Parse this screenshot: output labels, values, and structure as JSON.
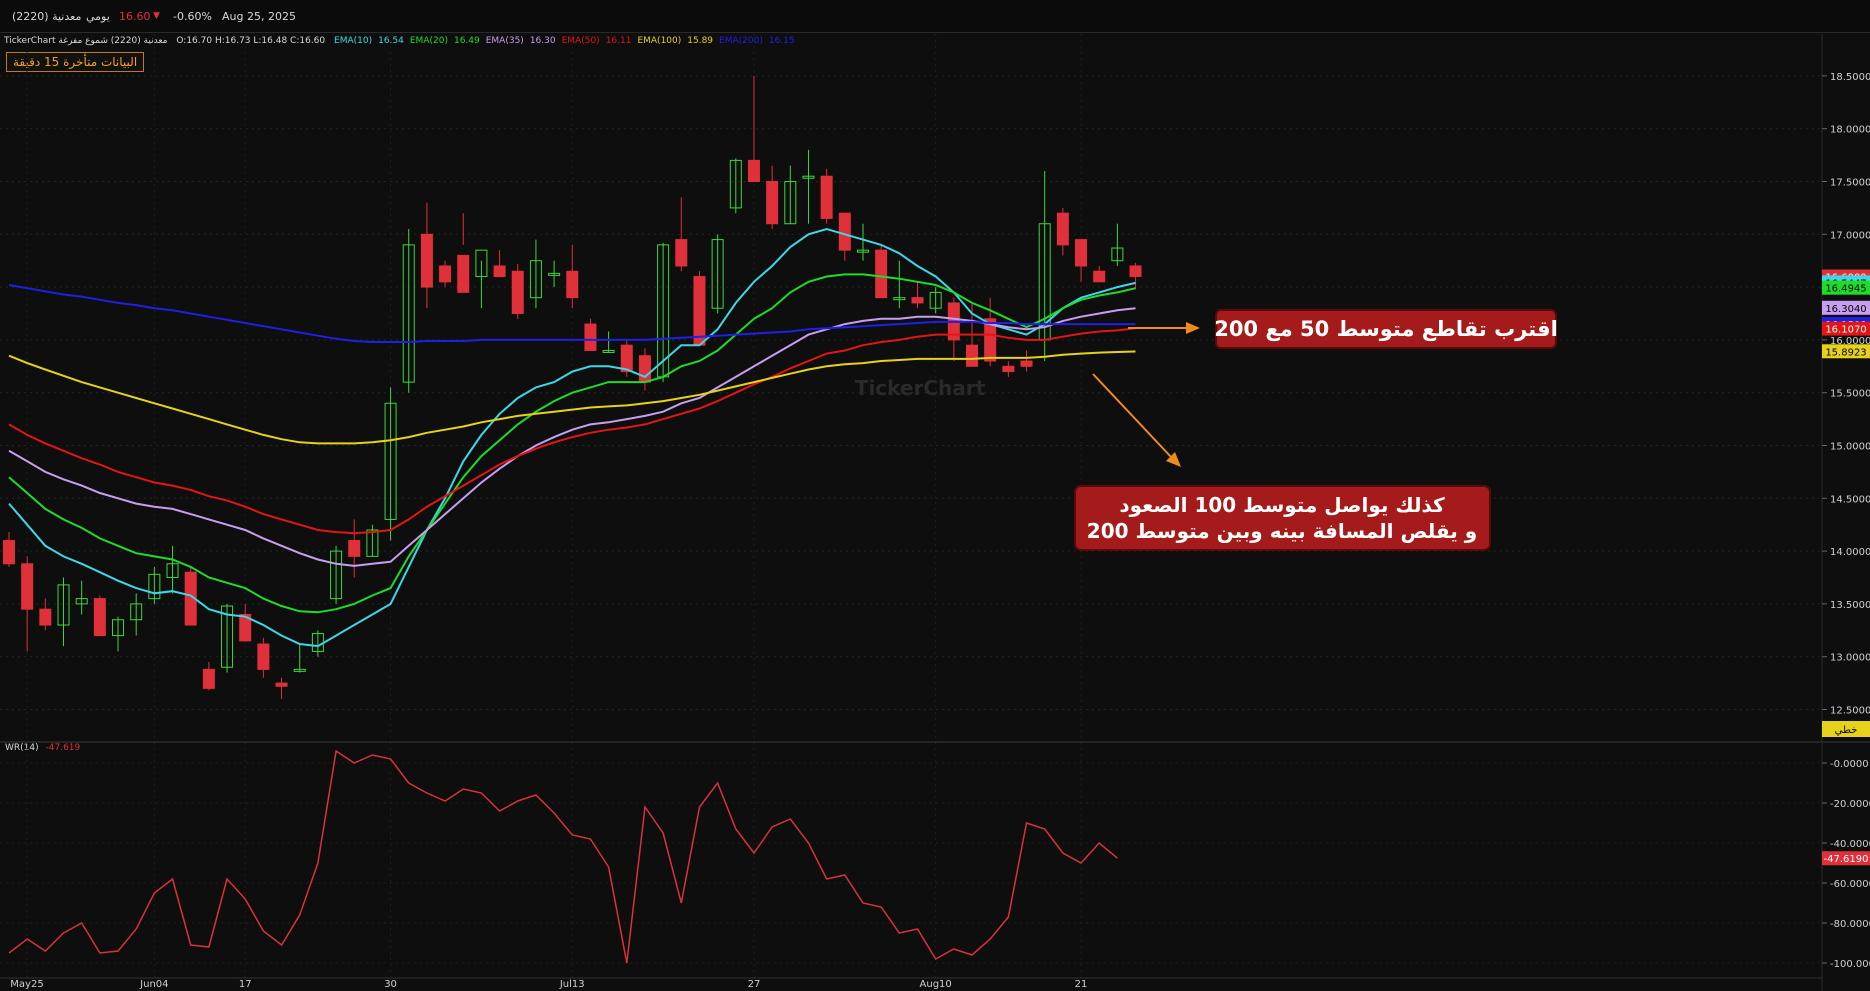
{
  "header": {
    "symbol": "معدنية (2220)",
    "period": "يومي",
    "price": "16.60",
    "change_pct": "-0.60%",
    "date": "Aug 25, 2025"
  },
  "legend": {
    "source": "TickerChart معدنية (2220) شموع مفرغة",
    "ohlc": "O:16.70  H:16.73  L:16.48  C:16.60",
    "items": [
      {
        "label": "EMA(10)",
        "value": "16.54",
        "color": "#3fd6e6"
      },
      {
        "label": "EMA(20)",
        "value": "16.49",
        "color": "#1fdc2a"
      },
      {
        "label": "EMA(35)",
        "value": "16.30",
        "color": "#c79ff0"
      },
      {
        "label": "EMA(50)",
        "value": "16.11",
        "color": "#e21616"
      },
      {
        "label": "EMA(100)",
        "value": "15.89",
        "color": "#e6d21a"
      },
      {
        "label": "EMA(200)",
        "value": "16.15",
        "color": "#1f1fe6"
      }
    ]
  },
  "delay_note": "البيانات متأخرة 15 دقيقة",
  "watermark": "TickerChart",
  "annotations": {
    "callout1": "اقترب  تقاطع  متوسط 50  مع  200",
    "callout2_line1": "كذلك  يواصل  متوسط 100  الصعود",
    "callout2_line2": "و  يقلص  المسافة  بينه  وبين  متوسط 200"
  },
  "price_tags": [
    {
      "text": "16.6000",
      "value": 16.6,
      "color": "#e0303a"
    },
    {
      "text": "16.5447",
      "value": 16.5447,
      "color": "#3fd6e6"
    },
    {
      "text": "16.4945",
      "value": 16.4945,
      "color": "#1fdc2a"
    },
    {
      "text": "16.3040",
      "value": 16.304,
      "color": "#c79ff0"
    },
    {
      "text": "16.1508",
      "value": 16.1508,
      "color": "#1f1fe6"
    },
    {
      "text": "16.1070",
      "value": 16.107,
      "color": "#e21616"
    },
    {
      "text": "15.8923",
      "value": 15.8923,
      "color": "#e6d21a"
    }
  ],
  "linear_label": "خطي",
  "wr": {
    "label": "WR(14)",
    "value": "-47.619",
    "tag": "-47.6190"
  },
  "chart_data": [
    {
      "type": "candlestick",
      "title": "معدنية (2220)",
      "x": [
        "May25",
        "",
        "",
        "",
        "",
        "",
        "",
        "",
        "Jun04",
        "",
        "",
        "",
        "",
        "17",
        "",
        "",
        "",
        "",
        "",
        "",
        "",
        "30",
        "",
        "",
        "",
        "",
        "",
        "",
        "",
        "",
        "",
        "Jul13",
        "",
        "",
        "",
        "",
        "",
        "",
        "",
        "",
        "",
        "27",
        "",
        "",
        "",
        "",
        "",
        "",
        "",
        "",
        "",
        "Aug10",
        "",
        "",
        "",
        "",
        "",
        "",
        "",
        "21",
        ""
      ],
      "x_tick_labels": [
        "May25",
        "Jun04",
        "17",
        "30",
        "Jul13",
        "27",
        "Aug10",
        "21"
      ],
      "y_ticks": [
        "12.5000",
        "13.0000",
        "13.5000",
        "14.0000",
        "14.5000",
        "15.0000",
        "15.5000",
        "16.0000",
        "16.5000",
        "17.0000",
        "17.5000",
        "18.0000",
        "18.5000"
      ],
      "ylim": [
        12.3,
        18.75
      ],
      "ohlc": [
        [
          14.1,
          14.18,
          13.85,
          13.88
        ],
        [
          13.88,
          13.95,
          13.05,
          13.45
        ],
        [
          13.45,
          13.55,
          13.25,
          13.3
        ],
        [
          13.3,
          13.75,
          13.1,
          13.68
        ],
        [
          13.5,
          13.72,
          13.4,
          13.55
        ],
        [
          13.55,
          13.58,
          13.2,
          13.2
        ],
        [
          13.2,
          13.38,
          13.05,
          13.35
        ],
        [
          13.35,
          13.6,
          13.2,
          13.5
        ],
        [
          13.55,
          13.85,
          13.5,
          13.78
        ],
        [
          13.75,
          14.05,
          13.6,
          13.88
        ],
        [
          13.8,
          13.85,
          13.3,
          13.3
        ],
        [
          12.88,
          12.95,
          12.68,
          12.7
        ],
        [
          12.9,
          13.5,
          12.85,
          13.48
        ],
        [
          13.4,
          13.5,
          13.15,
          13.15
        ],
        [
          13.12,
          13.18,
          12.8,
          12.88
        ],
        [
          12.75,
          12.8,
          12.6,
          12.72
        ],
        [
          12.88,
          13.12,
          12.85,
          12.88
        ],
        [
          13.05,
          13.25,
          13.0,
          13.22
        ],
        [
          13.55,
          14.05,
          13.5,
          14.0
        ],
        [
          14.1,
          14.3,
          13.75,
          13.95
        ],
        [
          13.95,
          14.25,
          13.95,
          14.2
        ],
        [
          14.3,
          15.55,
          14.1,
          15.4
        ],
        [
          15.6,
          17.05,
          15.5,
          16.9
        ],
        [
          17.0,
          17.3,
          16.3,
          16.5
        ],
        [
          16.7,
          16.75,
          16.5,
          16.55
        ],
        [
          16.8,
          17.2,
          16.9,
          16.45
        ],
        [
          16.6,
          16.75,
          16.3,
          16.85
        ],
        [
          16.7,
          16.85,
          16.6,
          16.6
        ],
        [
          16.65,
          16.72,
          16.2,
          16.25
        ],
        [
          16.4,
          16.95,
          16.3,
          16.75
        ],
        [
          16.63,
          16.75,
          16.5,
          16.63
        ],
        [
          16.65,
          16.9,
          16.3,
          16.4
        ],
        [
          16.15,
          16.2,
          15.9,
          15.9
        ],
        [
          15.9,
          16.08,
          15.88,
          15.9
        ],
        [
          15.95,
          16.0,
          15.65,
          15.7
        ],
        [
          15.85,
          15.92,
          15.52,
          15.6
        ],
        [
          15.65,
          16.92,
          15.6,
          16.9
        ],
        [
          16.95,
          17.35,
          16.65,
          16.7
        ],
        [
          16.6,
          16.65,
          15.95,
          15.95
        ],
        [
          16.3,
          17.0,
          16.25,
          16.95
        ],
        [
          17.25,
          17.72,
          17.2,
          17.7
        ],
        [
          17.7,
          18.5,
          17.6,
          17.5
        ],
        [
          17.5,
          17.65,
          17.05,
          17.1
        ],
        [
          17.1,
          17.65,
          17.1,
          17.5
        ],
        [
          17.55,
          17.8,
          17.1,
          17.55
        ],
        [
          17.55,
          17.62,
          17.1,
          17.15
        ],
        [
          17.2,
          17.2,
          16.75,
          16.85
        ],
        [
          16.85,
          17.1,
          16.75,
          16.85
        ],
        [
          16.85,
          16.9,
          16.4,
          16.4
        ],
        [
          16.4,
          16.75,
          16.3,
          16.4
        ],
        [
          16.4,
          16.55,
          16.3,
          16.35
        ],
        [
          16.3,
          16.5,
          16.25,
          16.45
        ],
        [
          16.35,
          16.4,
          15.8,
          16.0
        ],
        [
          15.95,
          16.35,
          15.85,
          15.75
        ],
        [
          16.2,
          16.4,
          15.75,
          15.8
        ],
        [
          15.75,
          15.8,
          15.65,
          15.7
        ],
        [
          15.8,
          15.9,
          15.7,
          15.75
        ],
        [
          16.0,
          17.6,
          15.8,
          17.1
        ],
        [
          17.2,
          17.25,
          16.8,
          16.9
        ],
        [
          16.95,
          16.95,
          16.55,
          16.7
        ],
        [
          16.65,
          16.7,
          16.55,
          16.55
        ],
        [
          16.75,
          17.1,
          16.7,
          16.87
        ],
        [
          16.7,
          16.73,
          16.48,
          16.6
        ]
      ],
      "series": [
        {
          "name": "EMA(10)",
          "color": "#3fd6e6",
          "values": [
            14.45,
            14.25,
            14.05,
            13.95,
            13.88,
            13.8,
            13.72,
            13.65,
            13.6,
            13.62,
            13.58,
            13.45,
            13.4,
            13.38,
            13.3,
            13.2,
            13.12,
            13.1,
            13.2,
            13.3,
            13.4,
            13.5,
            13.85,
            14.2,
            14.5,
            14.85,
            15.1,
            15.3,
            15.45,
            15.55,
            15.6,
            15.7,
            15.75,
            15.75,
            15.72,
            15.65,
            15.8,
            15.95,
            15.95,
            16.1,
            16.35,
            16.55,
            16.7,
            16.88,
            17.0,
            17.05,
            17.0,
            16.95,
            16.9,
            16.82,
            16.7,
            16.6,
            16.45,
            16.25,
            16.15,
            16.1,
            16.05,
            16.15,
            16.3,
            16.4,
            16.45,
            16.5,
            16.54
          ]
        },
        {
          "name": "EMA(20)",
          "color": "#1fdc2a",
          "values": [
            14.7,
            14.55,
            14.4,
            14.3,
            14.22,
            14.12,
            14.05,
            13.98,
            13.95,
            13.92,
            13.85,
            13.75,
            13.7,
            13.65,
            13.55,
            13.48,
            13.43,
            13.42,
            13.45,
            13.5,
            13.58,
            13.65,
            13.95,
            14.2,
            14.45,
            14.7,
            14.9,
            15.05,
            15.2,
            15.32,
            15.42,
            15.5,
            15.55,
            15.6,
            15.6,
            15.6,
            15.65,
            15.75,
            15.8,
            15.9,
            16.05,
            16.2,
            16.3,
            16.45,
            16.55,
            16.6,
            16.62,
            16.62,
            16.6,
            16.58,
            16.55,
            16.52,
            16.45,
            16.35,
            16.28,
            16.2,
            16.12,
            16.2,
            16.3,
            16.38,
            16.42,
            16.45,
            16.49
          ]
        },
        {
          "name": "EMA(35)",
          "color": "#c79ff0",
          "values": [
            14.95,
            14.85,
            14.75,
            14.68,
            14.62,
            14.55,
            14.5,
            14.45,
            14.42,
            14.4,
            14.35,
            14.3,
            14.25,
            14.2,
            14.12,
            14.05,
            13.98,
            13.92,
            13.88,
            13.86,
            13.88,
            13.9,
            14.05,
            14.2,
            14.35,
            14.5,
            14.65,
            14.78,
            14.9,
            15.0,
            15.08,
            15.15,
            15.2,
            15.22,
            15.25,
            15.28,
            15.32,
            15.4,
            15.45,
            15.55,
            15.65,
            15.75,
            15.85,
            15.95,
            16.05,
            16.1,
            16.15,
            16.18,
            16.2,
            16.2,
            16.22,
            16.22,
            16.2,
            16.18,
            16.15,
            16.12,
            16.1,
            16.12,
            16.18,
            16.22,
            16.25,
            16.28,
            16.3
          ]
        },
        {
          "name": "EMA(50)",
          "color": "#e21616",
          "values": [
            15.2,
            15.1,
            15.02,
            14.95,
            14.88,
            14.82,
            14.75,
            14.7,
            14.65,
            14.62,
            14.58,
            14.52,
            14.48,
            14.42,
            14.35,
            14.3,
            14.25,
            14.2,
            14.18,
            14.17,
            14.18,
            14.2,
            14.3,
            14.42,
            14.52,
            14.62,
            14.72,
            14.82,
            14.9,
            14.97,
            15.03,
            15.08,
            15.12,
            15.15,
            15.17,
            15.2,
            15.25,
            15.3,
            15.35,
            15.42,
            15.5,
            15.58,
            15.65,
            15.73,
            15.8,
            15.87,
            15.9,
            15.95,
            15.98,
            16.0,
            16.03,
            16.05,
            16.05,
            16.05,
            16.05,
            16.02,
            16.0,
            16.0,
            16.03,
            16.06,
            16.08,
            16.09,
            16.11
          ]
        },
        {
          "name": "EMA(100)",
          "color": "#e6d21a",
          "values": [
            15.85,
            15.78,
            15.72,
            15.66,
            15.6,
            15.55,
            15.5,
            15.45,
            15.4,
            15.35,
            15.3,
            15.25,
            15.2,
            15.15,
            15.1,
            15.06,
            15.03,
            15.02,
            15.02,
            15.02,
            15.03,
            15.05,
            15.08,
            15.12,
            15.15,
            15.18,
            15.22,
            15.25,
            15.28,
            15.3,
            15.32,
            15.34,
            15.36,
            15.37,
            15.38,
            15.4,
            15.42,
            15.45,
            15.48,
            15.52,
            15.56,
            15.6,
            15.64,
            15.68,
            15.72,
            15.75,
            15.77,
            15.78,
            15.8,
            15.81,
            15.82,
            15.82,
            15.82,
            15.82,
            15.83,
            15.83,
            15.83,
            15.84,
            15.86,
            15.87,
            15.88,
            15.885,
            15.89
          ]
        },
        {
          "name": "EMA(200)",
          "color": "#1f1fe6",
          "values": [
            16.52,
            16.49,
            16.46,
            16.43,
            16.41,
            16.38,
            16.35,
            16.33,
            16.3,
            16.28,
            16.25,
            16.22,
            16.19,
            16.16,
            16.13,
            16.1,
            16.07,
            16.04,
            16.01,
            15.99,
            15.98,
            15.98,
            15.98,
            15.99,
            15.99,
            15.99,
            16.0,
            16.0,
            16.0,
            16.0,
            16.0,
            16.0,
            16.0,
            16.0,
            16.0,
            16.0,
            16.01,
            16.02,
            16.03,
            16.04,
            16.05,
            16.06,
            16.07,
            16.08,
            16.1,
            16.11,
            16.12,
            16.13,
            16.14,
            16.15,
            16.16,
            16.17,
            16.17,
            16.17,
            16.16,
            16.16,
            16.15,
            16.15,
            16.15,
            16.15,
            16.15,
            16.15,
            16.15
          ]
        }
      ]
    },
    {
      "type": "line",
      "title": "WR(14)",
      "y_ticks": [
        "-0.0000",
        "-20.0000",
        "-40.0000",
        "-60.0000",
        "-80.0000",
        "-100.0000"
      ],
      "ylim": [
        -104,
        5
      ],
      "series": [
        {
          "name": "WR(14)",
          "color": "#d8333b",
          "values": [
            -95,
            -88,
            -94,
            -85,
            -80,
            -95,
            -94,
            -83,
            -65,
            -58,
            -91,
            -92,
            -58,
            -68,
            -84,
            -91,
            -76,
            -50,
            6,
            0,
            4,
            2,
            -10,
            -15,
            -19,
            -13,
            -15,
            -24,
            -19,
            -16,
            -25,
            -36,
            -38,
            -52,
            -100,
            -22,
            -35,
            -70,
            -22,
            -10,
            -33,
            -45,
            -32,
            -28,
            -40,
            -58,
            -56,
            -70,
            -72,
            -85,
            -83,
            -98,
            -93,
            -96,
            -88,
            -77,
            -30,
            -33,
            -45,
            -50,
            -40,
            -47.619
          ]
        }
      ]
    }
  ]
}
